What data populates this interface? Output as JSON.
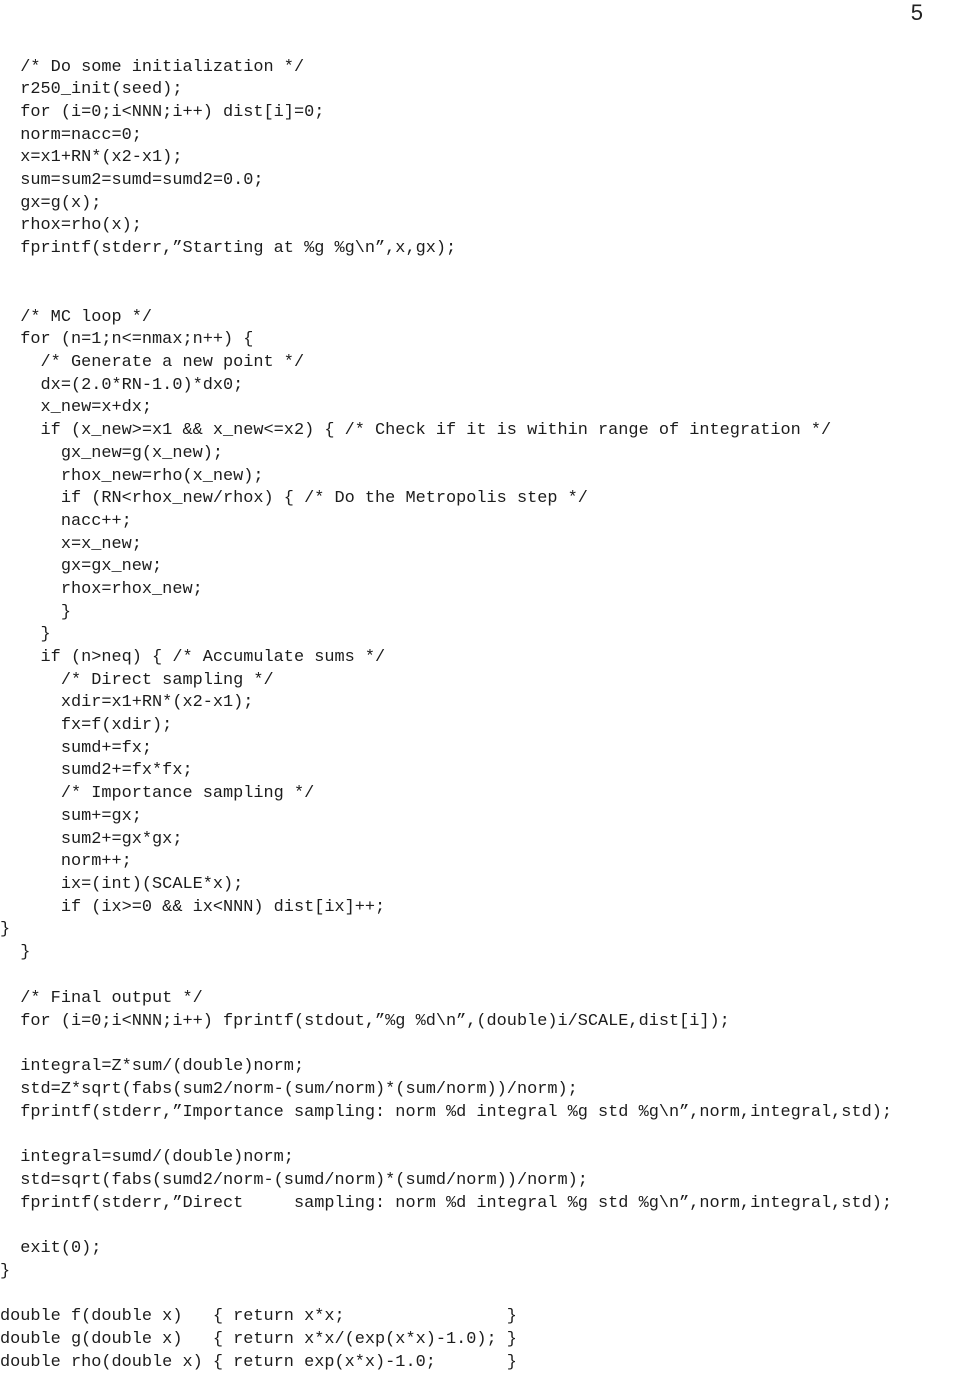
{
  "page": {
    "number": "5"
  },
  "code": {
    "lines": [
      {
        "text": "  /* Do some initialization */",
        "kind": "comment"
      },
      {
        "text": "  r250_init(seed);",
        "kind": "code"
      },
      {
        "text": "  for (i=0;i<NNN;i++) dist[i]=0;",
        "kind": "code"
      },
      {
        "text": "  norm=nacc=0;",
        "kind": "code"
      },
      {
        "text": "  x=x1+RN*(x2-x1);",
        "kind": "code"
      },
      {
        "text": "  sum=sum2=sumd=sumd2=0.0;",
        "kind": "code"
      },
      {
        "text": "  gx=g(x);",
        "kind": "code"
      },
      {
        "text": "  rhox=rho(x);",
        "kind": "code"
      },
      {
        "text": "  fprintf(stderr,”Starting at %g %g\\n”,x,gx);",
        "kind": "code"
      },
      {
        "text": "  /* MC loop */",
        "kind": "comment"
      },
      {
        "text": "  for (n=1;n<=nmax;n++) {",
        "kind": "code"
      },
      {
        "text": "    /* Generate a new point */",
        "kind": "comment"
      },
      {
        "text": "    dx=(2.0*RN-1.0)*dx0;",
        "kind": "code"
      },
      {
        "text": "    x_new=x+dx;",
        "kind": "code"
      },
      {
        "text": "    if (x_new>=x1 && x_new<=x2) { /* Check if it is within range of integration */",
        "kind": "code"
      },
      {
        "text": "      gx_new=g(x_new);",
        "kind": "code"
      },
      {
        "text": "      rhox_new=rho(x_new);",
        "kind": "code"
      },
      {
        "text": "      if (RN<rhox_new/rhox) { /* Do the Metropolis step */",
        "kind": "code"
      },
      {
        "text": "      nacc++;",
        "kind": "code"
      },
      {
        "text": "      x=x_new;",
        "kind": "code"
      },
      {
        "text": "      gx=gx_new;",
        "kind": "code"
      },
      {
        "text": "      rhox=rhox_new;",
        "kind": "code"
      },
      {
        "text": "      }",
        "kind": "code"
      },
      {
        "text": "    }",
        "kind": "code"
      },
      {
        "text": "    if (n>neq) { /* Accumulate sums */",
        "kind": "code"
      },
      {
        "text": "      /* Direct sampling */",
        "kind": "comment"
      },
      {
        "text": "      xdir=x1+RN*(x2-x1);",
        "kind": "code"
      },
      {
        "text": "      fx=f(xdir);",
        "kind": "code"
      },
      {
        "text": "      sumd+=fx;",
        "kind": "code"
      },
      {
        "text": "      sumd2+=fx*fx;",
        "kind": "code"
      },
      {
        "text": "      /* Importance sampling */",
        "kind": "comment"
      },
      {
        "text": "      sum+=gx;",
        "kind": "code"
      },
      {
        "text": "      sum2+=gx*gx;",
        "kind": "code"
      },
      {
        "text": "      norm++;",
        "kind": "code"
      },
      {
        "text": "      ix=(int)(SCALE*x);",
        "kind": "code"
      },
      {
        "text": "      if (ix>=0 && ix<NNN) dist[ix]++;",
        "kind": "code"
      },
      {
        "text": "}",
        "kind": "code"
      },
      {
        "text": "  }",
        "kind": "code"
      },
      {
        "text": "  /* Final output */",
        "kind": "comment"
      },
      {
        "text": "  for (i=0;i<NNN;i++) fprintf(stdout,”%g %d\\n”,(double)i/SCALE,dist[i]);",
        "kind": "code"
      },
      {
        "text": "  integral=Z*sum/(double)norm;",
        "kind": "code"
      },
      {
        "text": "  std=Z*sqrt(fabs(sum2/norm-(sum/norm)*(sum/norm))/norm);",
        "kind": "code"
      },
      {
        "text": "  fprintf(stderr,”Importance sampling: norm %d integral %g std %g\\n”,norm,integral,std);",
        "kind": "code"
      },
      {
        "text": "  integral=sumd/(double)norm;",
        "kind": "code"
      },
      {
        "text": "  std=sqrt(fabs(sumd2/norm-(sumd/norm)*(sumd/norm))/norm);",
        "kind": "code"
      },
      {
        "text": "  fprintf(stderr,”Direct     sampling: norm %d integral %g std %g\\n”,norm,integral,std);",
        "kind": "code"
      },
      {
        "text": "  exit(0);",
        "kind": "code"
      },
      {
        "text": "}",
        "kind": "code"
      },
      {
        "text": "double f(double x)   { return x*x;                }",
        "kind": "code"
      },
      {
        "text": "double g(double x)   { return x*x/(exp(x*x)-1.0); }",
        "kind": "code"
      },
      {
        "text": "double rho(double x) { return exp(x*x)-1.0;       }",
        "kind": "code"
      }
    ]
  }
}
